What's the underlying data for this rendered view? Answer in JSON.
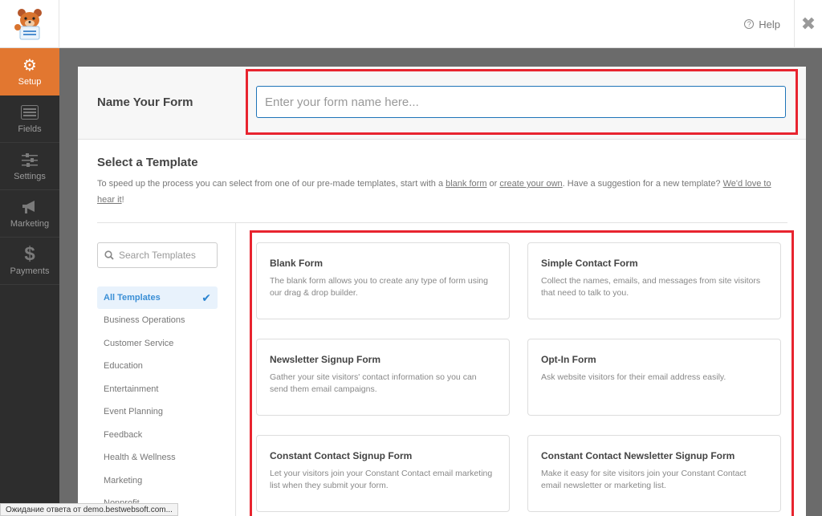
{
  "topbar": {
    "help_label": "Help",
    "help_icon": "question-circle-icon",
    "close_icon": "close-icon"
  },
  "leftnav": {
    "items": [
      {
        "label": "Setup",
        "icon": "gear-icon",
        "active": true
      },
      {
        "label": "Fields",
        "icon": "list-icon",
        "active": false
      },
      {
        "label": "Settings",
        "icon": "sliders-icon",
        "active": false
      },
      {
        "label": "Marketing",
        "icon": "megaphone-icon",
        "active": false
      },
      {
        "label": "Payments",
        "icon": "dollar-icon",
        "active": false
      }
    ]
  },
  "name_form": {
    "label": "Name Your Form",
    "placeholder": "Enter your form name here...",
    "value": ""
  },
  "select_template": {
    "title": "Select a Template",
    "desc_part1": "To speed up the process you can select from one of our pre-made templates, start with a ",
    "link_blank": "blank form",
    "desc_part2": " or ",
    "link_create": "create your own",
    "desc_part3": ". Have a suggestion for a new template? ",
    "link_suggest": "We'd love to hear it",
    "desc_part4": "!"
  },
  "categories": {
    "search_placeholder": "Search Templates",
    "items": [
      {
        "label": "All Templates",
        "active": true
      },
      {
        "label": "Business Operations"
      },
      {
        "label": "Customer Service"
      },
      {
        "label": "Education"
      },
      {
        "label": "Entertainment"
      },
      {
        "label": "Event Planning"
      },
      {
        "label": "Feedback"
      },
      {
        "label": "Health & Wellness"
      },
      {
        "label": "Marketing"
      },
      {
        "label": "Nonprofit"
      }
    ]
  },
  "templates": [
    {
      "name": "Blank Form",
      "desc": "The blank form allows you to create any type of form using our drag & drop builder."
    },
    {
      "name": "Simple Contact Form",
      "desc": "Collect the names, emails, and messages from site visitors that need to talk to you."
    },
    {
      "name": "Newsletter Signup Form",
      "desc": "Gather your site visitors' contact information so you can send them email campaigns."
    },
    {
      "name": "Opt-In Form",
      "desc": "Ask website visitors for their email address easily."
    },
    {
      "name": "Constant Contact Signup Form",
      "desc": "Let your visitors join your Constant Contact email marketing list when they submit your form."
    },
    {
      "name": "Constant Contact Newsletter Signup Form",
      "desc": "Make it easy for site visitors join your Constant Contact email newsletter or marketing list."
    }
  ],
  "status_bar": {
    "text": "Ожидание ответа от demo.bestwebsoft.com..."
  },
  "colors": {
    "accent": "#e27730",
    "highlight": "#e8242f",
    "link_blue": "#3a8fd6"
  }
}
